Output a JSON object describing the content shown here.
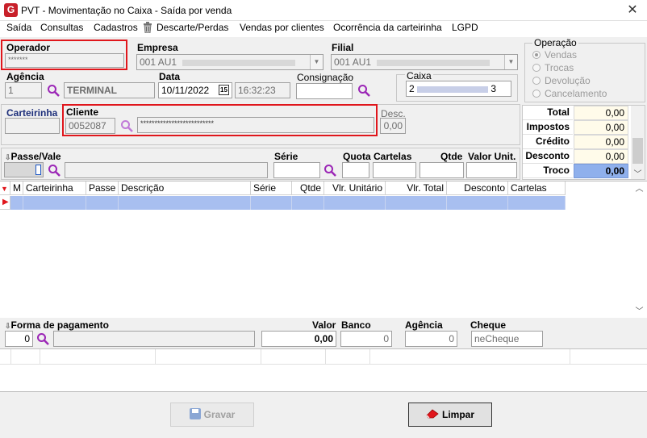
{
  "window": {
    "title": "PVT - Movimentação no Caixa - Saída por venda",
    "logo": "G"
  },
  "menu": [
    "Saída",
    "Consultas",
    "Cadastros",
    "Descarte/Perdas",
    "Vendas por clientes",
    "Ocorrência da carteirinha",
    "LGPD"
  ],
  "operador": {
    "label": "Operador",
    "value": "*******"
  },
  "empresa": {
    "label": "Empresa",
    "value": "001 AU1"
  },
  "filial": {
    "label": "Filial",
    "value": "001 AU1"
  },
  "operacao": {
    "label": "Operação",
    "options": [
      "Vendas",
      "Trocas",
      "Devolução",
      "Cancelamento"
    ],
    "selected": "Vendas"
  },
  "agencia": {
    "label": "Agência",
    "code": "1",
    "name": "TERMINAL"
  },
  "data": {
    "label": "Data",
    "date": "10/11/2022",
    "cal_icon": "15",
    "time": "16:32:23"
  },
  "consignacao": {
    "label": "Consignação",
    "value": ""
  },
  "caixa": {
    "label": "Caixa",
    "value_start": "2",
    "value_end": "3"
  },
  "totals": [
    {
      "label": "Total",
      "value": "0,00"
    },
    {
      "label": "Impostos",
      "value": "0,00"
    },
    {
      "label": "Crédito",
      "value": "0,00"
    },
    {
      "label": "Desconto",
      "value": "0,00"
    },
    {
      "label": "Troco",
      "value": "0,00"
    }
  ],
  "carteirinha": {
    "label": "Carteirinha",
    "value": ""
  },
  "cliente": {
    "label": "Cliente",
    "code": "0052087",
    "name": "**************************"
  },
  "desc": {
    "label": "Desc.",
    "value": "0,00"
  },
  "passe": {
    "label": "Passe/Vale",
    "serie_label": "Série",
    "quota_label": "Quota",
    "cartelas_label": "Cartelas",
    "qtde_label": "Qtde",
    "valor_label": "Valor Unit."
  },
  "grid": {
    "columns": [
      "M",
      "Carteirinha",
      "Passe",
      "Descrição",
      "Série",
      "Qtde",
      "Vlr. Unitário",
      "Vlr. Total",
      "Desconto",
      "Cartelas"
    ]
  },
  "pagamento": {
    "label": "Forma de pagamento",
    "code": "0",
    "valor_label": "Valor",
    "valor": "0,00",
    "banco_label": "Banco",
    "banco": "0",
    "agencia_label": "Agência",
    "agencia": "0",
    "cheque_label": "Cheque",
    "cheque": "neCheque"
  },
  "buttons": {
    "gravar": "Gravar",
    "limpar": "Limpar"
  },
  "colors": {
    "highlight_red": "#e0161c",
    "grid_selected_row": "#a8bff0",
    "troco_bg": "#8fb0ec",
    "search_icon": "#9b26b6"
  }
}
